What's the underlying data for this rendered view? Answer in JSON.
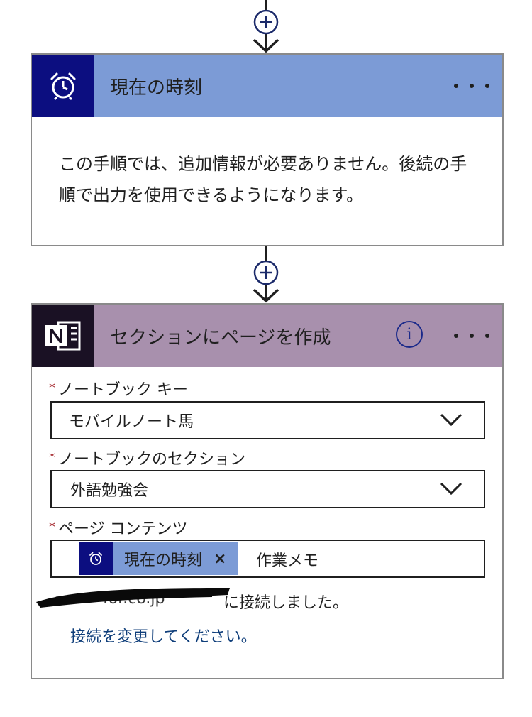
{
  "step_clock": {
    "title": "現在の時刻",
    "icon": "alarm-clock-icon",
    "description": "この手順では、追加情報が必要ありません。後続の手順で出力を使用できるようになります。"
  },
  "step_onenote": {
    "title": "セクションにページを作成",
    "icon": "onenote-icon",
    "info_glyph": "i",
    "fields": {
      "notebook_key": {
        "required_mark": "*",
        "label": "ノートブック キー",
        "value": "モバイルノート馬"
      },
      "notebook_section": {
        "required_mark": "*",
        "label": "ノートブックのセクション",
        "value": "外語勉強会"
      },
      "page_content": {
        "required_mark": "*",
        "label": "ページ コンテンツ",
        "token_label": "現在の時刻",
        "token_remove": "×",
        "text_after_token": "作業メモ"
      }
    },
    "connection": {
      "account_suffix": "for.co.jp",
      "connected_text": "に接続しました。",
      "change_link": "接続を変更してください。"
    }
  },
  "colors": {
    "clock_header": "#7c9bd6",
    "clock_icon_bg": "#0c0e80",
    "onenote_header": "#a890ad",
    "onenote_icon_bg": "#1a1124",
    "link": "#0f3e7a",
    "required": "#a4262c"
  }
}
